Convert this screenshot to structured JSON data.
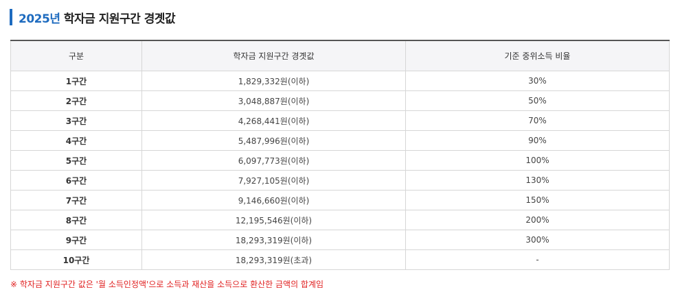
{
  "header": {
    "year": "2025년",
    "title": "학자금 지원구간 경곗값"
  },
  "table": {
    "columns": [
      "구분",
      "학자금 지원구간 경곗값",
      "기준 중위소득 비율"
    ],
    "rows": [
      [
        "1구간",
        "1,829,332원(이하)",
        "30%"
      ],
      [
        "2구간",
        "3,048,887원(이하)",
        "50%"
      ],
      [
        "3구간",
        "4,268,441원(이하)",
        "70%"
      ],
      [
        "4구간",
        "5,487,996원(이하)",
        "90%"
      ],
      [
        "5구간",
        "6,097,773원(이하)",
        "100%"
      ],
      [
        "6구간",
        "7,927,105원(이하)",
        "130%"
      ],
      [
        "7구간",
        "9,146,660원(이하)",
        "150%"
      ],
      [
        "8구간",
        "12,195,546원(이하)",
        "200%"
      ],
      [
        "9구간",
        "18,293,319원(이하)",
        "300%"
      ],
      [
        "10구간",
        "18,293,319원(초과)",
        "-"
      ]
    ]
  },
  "note": "※ 학자금 지원구간 값은 '월 소득인정액'으로 소득과 재산을 소득으로 환산한 금액의 합계임",
  "colors": {
    "accent": "#1e6bbf",
    "note": "#e02020",
    "header_bg": "#f5f5f7"
  }
}
